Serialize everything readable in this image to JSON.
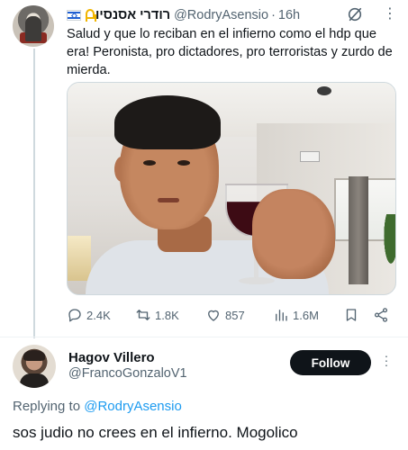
{
  "parent_tweet": {
    "display_name": "רודרי אסנסיו",
    "handle": "@RodryAsensio",
    "separator": "·",
    "time": "16h",
    "text": "Salud y que lo reciban en el infierno como el hdp que era! Peronista, pro dictadores, pro terroristas y zurdo de mierda.",
    "icons": {
      "flag": "israel-flag-icon",
      "ribbon": "yellow-ribbon-icon",
      "grok": "grok-icon",
      "more": "more-icon"
    },
    "photo_alt": "photo-man-raising-wine-glass"
  },
  "actions": {
    "reply_count": "2.4K",
    "retweet_count": "1.8K",
    "like_count": "857",
    "views_count": "1.6M",
    "icons": [
      "reply-icon",
      "retweet-icon",
      "like-icon",
      "views-icon",
      "bookmark-icon",
      "share-icon"
    ]
  },
  "reply": {
    "display_name": "Hagov Villero",
    "handle": "@FrancoGonzaloV1",
    "follow_label": "Follow",
    "replying_prefix": "Replying to",
    "replying_mention": "@RodryAsensio",
    "text": "sos judio no crees en el infierno. Mogolico"
  },
  "colors": {
    "text_primary": "#0f1419",
    "text_secondary": "#536471",
    "accent_blue": "#1d9bf0",
    "follow_bg": "#0f1419",
    "ribbon_yellow": "#f1b500"
  }
}
